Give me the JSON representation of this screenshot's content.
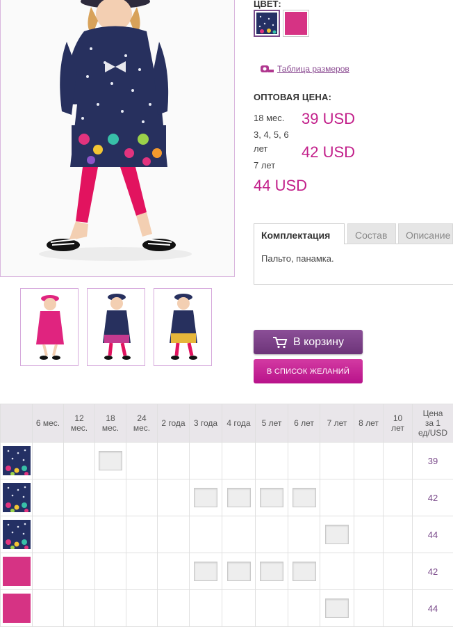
{
  "colors": {
    "accent_pink": "#c21f8a",
    "accent_purple": "#7a4a8a",
    "navy_print": "#243064",
    "pink_swatch": "#d63384"
  },
  "color_picker": {
    "label": "ЦВЕТ:",
    "options": [
      "navy-print",
      "pink"
    ],
    "selected": "navy-print"
  },
  "size_table_link": "Таблица размеров",
  "wholesale": {
    "title": "ОПТОВАЯ ЦЕНА:",
    "rows": [
      {
        "label": "18 мес.",
        "price": "39 USD"
      },
      {
        "label": "3, 4, 5, 6 лет",
        "price": "42 USD"
      },
      {
        "label": "7 лет",
        "price": "44 USD"
      }
    ],
    "label_line_1": "3, 4, 5, 6",
    "label_line_2": "лет"
  },
  "tabs": [
    {
      "label": "Комплектация",
      "active": true
    },
    {
      "label": "Состав",
      "active": false
    },
    {
      "label": "Описание",
      "active": false
    }
  ],
  "tab_content": "Пальто, панамка.",
  "buttons": {
    "cart": "В корзину",
    "wishlist": "В СПИСОК ЖЕЛАНИЙ"
  },
  "size_grid": {
    "headers": [
      "6 мес.",
      "12 мес.",
      "18 мес.",
      "24 мес.",
      "2 года",
      "3 года",
      "4 года",
      "5 лет",
      "6 лет",
      "7 лет",
      "8 лет",
      "10 лет",
      "Цена за 1 ед/USD"
    ],
    "header_lines": [
      [
        "6 мес."
      ],
      [
        "12",
        "мес."
      ],
      [
        "18",
        "мес."
      ],
      [
        "24",
        "мес."
      ],
      [
        "2 года"
      ],
      [
        "3 года"
      ],
      [
        "4 года"
      ],
      [
        "5 лет"
      ],
      [
        "6 лет"
      ],
      [
        "7 лет"
      ],
      [
        "8 лет"
      ],
      [
        "10",
        "лет"
      ],
      [
        "Цена",
        "за 1",
        "ед/USD"
      ]
    ],
    "rows": [
      {
        "color": "navy-print",
        "available": [
          2
        ],
        "price": "39"
      },
      {
        "color": "navy-print",
        "available": [
          5,
          6,
          7,
          8
        ],
        "price": "42"
      },
      {
        "color": "navy-print",
        "available": [
          9
        ],
        "price": "44"
      },
      {
        "color": "pink",
        "available": [
          5,
          6,
          7,
          8
        ],
        "price": "42"
      },
      {
        "color": "pink",
        "available": [
          9
        ],
        "price": "44"
      }
    ]
  }
}
